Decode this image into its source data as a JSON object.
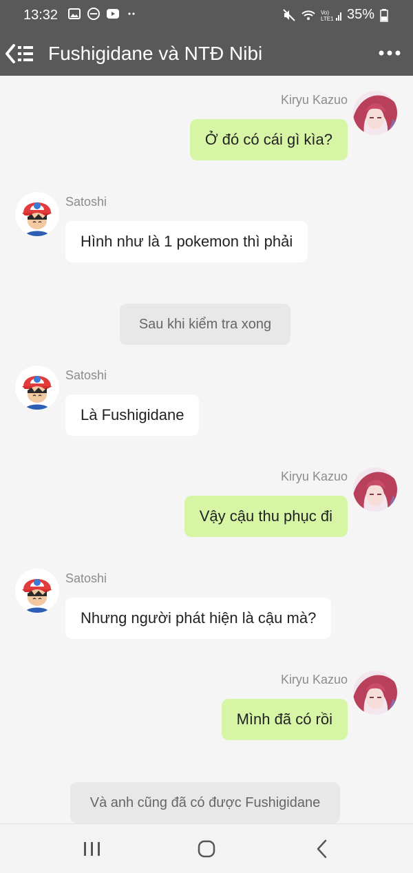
{
  "status_bar": {
    "time": "13:32",
    "battery": "35%",
    "icons_left": [
      "gallery-icon",
      "do-not-disturb-icon",
      "youtube-icon",
      "more-dots-icon"
    ],
    "icons_right": [
      "mute-icon",
      "wifi-icon",
      "volte-signal-icon",
      "battery-icon"
    ]
  },
  "app_bar": {
    "title": "Fushigidane và NTĐ Nibi",
    "back_icon": "back-menu-icon",
    "more_icon": "more-horizontal-icon"
  },
  "messages": [
    {
      "kind": "outgoing",
      "sender": "Kiryu Kazuo",
      "text": "Ở đó có cái gì kìa?"
    },
    {
      "kind": "incoming",
      "sender": "Satoshi",
      "text": "Hình như là 1 pokemon thì phải"
    },
    {
      "kind": "narration",
      "text": "Sau khi kiểm tra xong"
    },
    {
      "kind": "incoming",
      "sender": "Satoshi",
      "text": "Là Fushigidane"
    },
    {
      "kind": "outgoing",
      "sender": "Kiryu Kazuo",
      "text": "Vậy cậu thu phục đi"
    },
    {
      "kind": "incoming",
      "sender": "Satoshi",
      "text": "Nhưng người phát hiện là cậu mà?"
    },
    {
      "kind": "outgoing",
      "sender": "Kiryu Kazuo",
      "text": "Mình đã có rồi"
    },
    {
      "kind": "narration",
      "text": "Và anh cũng đã có được Fushigidane"
    }
  ],
  "colors": {
    "header_bg": "#595959",
    "chat_bg": "#f5f5f5",
    "outgoing_bubble": "#d7f6a5",
    "incoming_bubble": "#ffffff",
    "narration_bubble": "#e8e8e8"
  },
  "nav_bar": {
    "icons": [
      "recents-icon",
      "home-icon",
      "back-icon"
    ]
  }
}
